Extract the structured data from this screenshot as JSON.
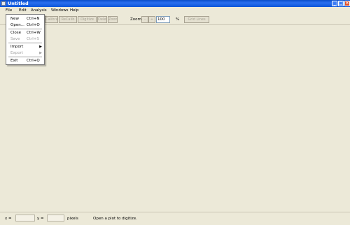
{
  "window": {
    "title": "Untitled"
  },
  "menubar": {
    "items": [
      "File",
      "Edit",
      "Analysis",
      "Windows",
      "Help"
    ]
  },
  "toolbar": {
    "buttons": [
      "Calibrate",
      "ReCalib",
      "Digitize",
      "Delete",
      "Zoom"
    ],
    "zoom_label": "Zoom",
    "zoom_minus": "-",
    "zoom_plus": "+",
    "zoom_value": "100",
    "zoom_unit": "%",
    "grid_lines": "Grid Lines"
  },
  "file_menu": {
    "items": [
      {
        "label": "New",
        "shortcut": "Ctrl+N",
        "enabled": true
      },
      {
        "label": "Open...",
        "shortcut": "Ctrl+O",
        "enabled": true
      },
      {
        "label": "Close",
        "shortcut": "Ctrl+W",
        "enabled": true
      },
      {
        "label": "Save",
        "shortcut": "Ctrl+S",
        "enabled": false
      },
      {
        "label": "Import",
        "shortcut": "",
        "enabled": true,
        "submenu": true
      },
      {
        "label": "Export",
        "shortcut": "",
        "enabled": false,
        "submenu": true
      },
      {
        "label": "Exit",
        "shortcut": "Ctrl+Q",
        "enabled": true
      }
    ],
    "submenu_arrow": "▶"
  },
  "statusbar": {
    "x_label": "x =",
    "y_label": "y =",
    "units": "pixels",
    "message": "Open a plot to digitize."
  },
  "colors": {
    "titlebar": "#0a4ec9",
    "background": "#ece9d8"
  }
}
